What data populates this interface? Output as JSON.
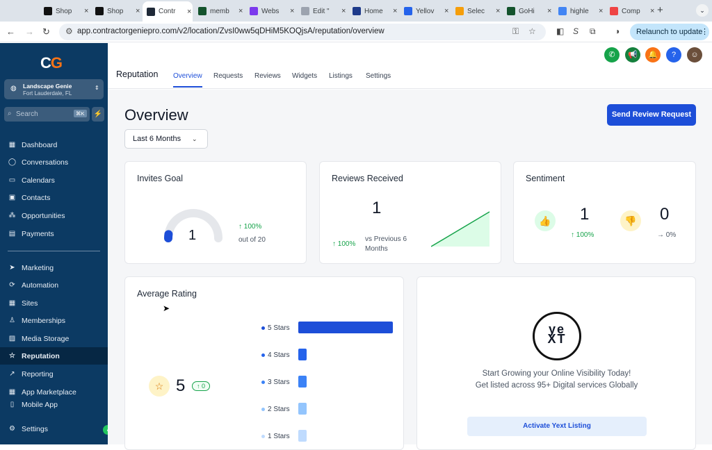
{
  "browser": {
    "tabs": [
      {
        "label": "Shop",
        "color": "#111111"
      },
      {
        "label": "Shop",
        "color": "#111111"
      },
      {
        "label": "Contr",
        "color": "#1f2937",
        "active": true
      },
      {
        "label": "memb",
        "color": "#14532d"
      },
      {
        "label": "Webs",
        "color": "#7c3aed"
      },
      {
        "label": "Edit \"",
        "color": "#9ca3af"
      },
      {
        "label": "Home",
        "color": "#1e3a8a"
      },
      {
        "label": "Yellov",
        "color": "#2563eb"
      },
      {
        "label": "Selec",
        "color": "#f59e0b"
      },
      {
        "label": "GoHi",
        "color": "#14532d"
      },
      {
        "label": "highle",
        "color": "#4285f4"
      },
      {
        "label": "Comp",
        "color": "#ef4444"
      }
    ],
    "url": "app.contractorgeniepro.com/v2/location/ZvsI0ww5qDHiM5KOQjsA/reputation/overview",
    "relaunch_label": "Relaunch to update"
  },
  "sidebar": {
    "logo_c": "C",
    "logo_g": "G",
    "account_name": "Landscape Genie",
    "account_location": "Fort Lauderdale, FL",
    "search_placeholder": "Search",
    "search_shortcut": "⌘K",
    "items": [
      {
        "label": "Dashboard",
        "icon": "▦"
      },
      {
        "label": "Conversations",
        "icon": "◯"
      },
      {
        "label": "Calendars",
        "icon": "▭"
      },
      {
        "label": "Contacts",
        "icon": "▣"
      },
      {
        "label": "Opportunities",
        "icon": "⁂"
      },
      {
        "label": "Payments",
        "icon": "▤"
      },
      {
        "label": "Marketing",
        "icon": "➤"
      },
      {
        "label": "Automation",
        "icon": "⟳"
      },
      {
        "label": "Sites",
        "icon": "▦"
      },
      {
        "label": "Memberships",
        "icon": "♙"
      },
      {
        "label": "Media Storage",
        "icon": "▨"
      },
      {
        "label": "Reputation",
        "icon": "☆"
      },
      {
        "label": "Reporting",
        "icon": "↗"
      },
      {
        "label": "App Marketplace",
        "icon": "▦"
      },
      {
        "label": "Mobile App",
        "icon": "▯"
      }
    ],
    "settings_label": "Settings"
  },
  "subnav": {
    "title": "Reputation",
    "tabs": [
      "Overview",
      "Requests",
      "Reviews",
      "Widgets",
      "Listings",
      "Settings"
    ]
  },
  "header_icons": {
    "phone": "#16a34a",
    "megaphone": "#15803d",
    "bell": "#f97316",
    "help": "#2563eb"
  },
  "overview": {
    "title": "Overview",
    "send_button": "Send Review Request",
    "range": "Last 6 Months",
    "invites": {
      "title": "Invites Goal",
      "value": "1",
      "change": "↑ 100%",
      "sub": "out of 20",
      "progress": 0.05
    },
    "reviews": {
      "title": "Reviews Received",
      "value": "1",
      "change": "↑ 100%",
      "sub_line1": "vs Previous 6",
      "sub_line2": "Months"
    },
    "sentiment": {
      "title": "Sentiment",
      "positive": "1",
      "positive_change": "↑ 100%",
      "negative": "0",
      "negative_change": "→ 0%"
    },
    "rating": {
      "title": "Average Rating",
      "value": "5",
      "change": "↑ 0",
      "stars": [
        {
          "label": "5 Stars",
          "count": 1,
          "color": "#1d4ed8"
        },
        {
          "label": "4 Stars",
          "count": 0,
          "color": "#2563eb"
        },
        {
          "label": "3 Stars",
          "count": 0,
          "color": "#3b82f6"
        },
        {
          "label": "2 Stars",
          "count": 0,
          "color": "#93c5fd"
        },
        {
          "label": "1 Stars",
          "count": 0,
          "color": "#bfdbfe"
        }
      ]
    },
    "yext": {
      "logo_top": "ye",
      "logo_bottom": "XT",
      "line1": "Start Growing your Online Visibility Today!",
      "line2": "Get listed across 95+ Digital services Globally",
      "button": "Activate Yext Listing"
    }
  }
}
